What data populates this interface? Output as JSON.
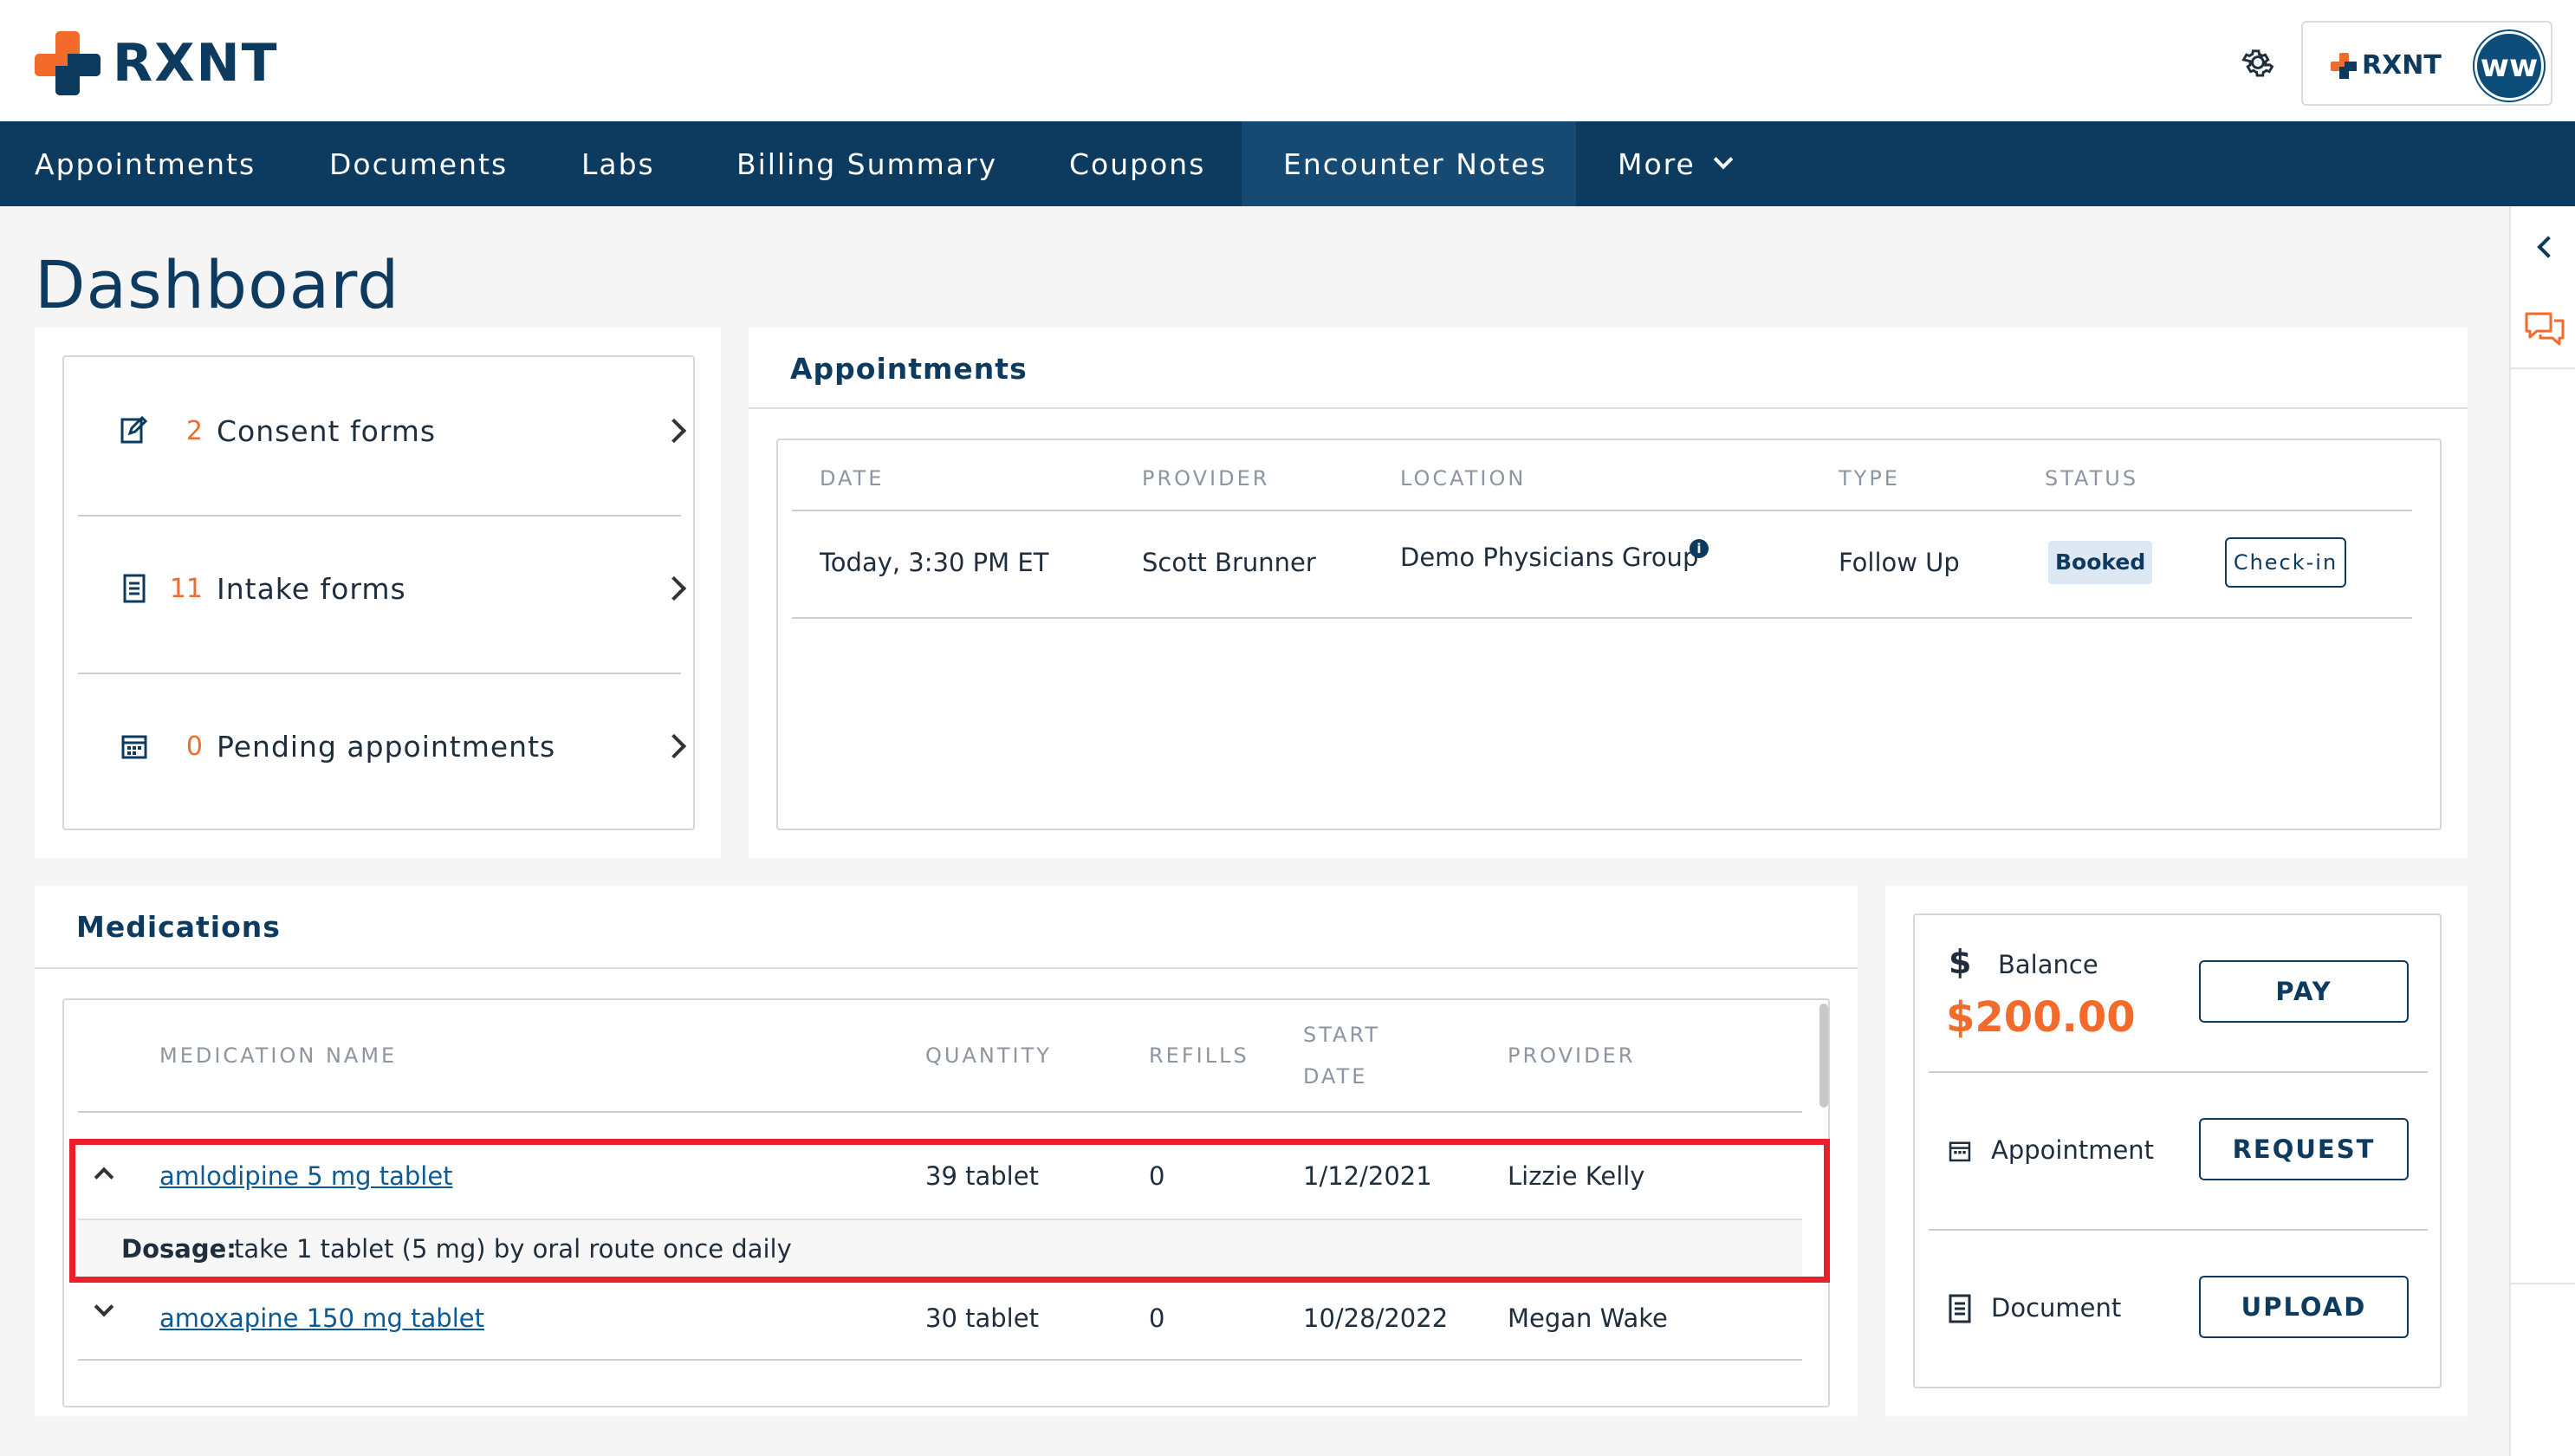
{
  "brand": {
    "name": "RXNT",
    "small_name": "RXNT",
    "orange": "#f26b2a",
    "navy": "#0d3a5f"
  },
  "header": {
    "settings_icon": "gear-icon",
    "avatar_initials": "ww"
  },
  "nav": {
    "items": [
      "Appointments",
      "Documents",
      "Labs",
      "Billing Summary",
      "Coupons",
      "Encounter Notes",
      "More"
    ],
    "active": "Encounter Notes"
  },
  "page": {
    "title": "Dashboard"
  },
  "forms": [
    {
      "count": "2",
      "label": "Consent forms",
      "icon": "edit-document-icon"
    },
    {
      "count": "11",
      "label": "Intake forms",
      "icon": "clipboard-icon"
    },
    {
      "count": "0",
      "label": "Pending appointments",
      "icon": "calendar-icon"
    }
  ],
  "appointments": {
    "title": "Appointments",
    "columns": [
      "DATE",
      "PROVIDER",
      "LOCATION",
      "TYPE",
      "STATUS"
    ],
    "rows": [
      {
        "date": "Today, 3:30 PM ET",
        "provider": "Scott Brunner",
        "location": "Demo Physicians Group",
        "info": "i",
        "type": "Follow Up",
        "status": "Booked",
        "action": "Check-in"
      }
    ]
  },
  "medications": {
    "title": "Medications",
    "columns": {
      "name": "MEDICATION NAME",
      "quantity": "QUANTITY",
      "refills": "REFILLS",
      "start_line1": "START",
      "start_line2": "DATE",
      "provider": "PROVIDER"
    },
    "rows": [
      {
        "name": "amlodipine 5 mg tablet",
        "quantity": "39 tablet",
        "refills": "0",
        "start": "1/12/2021",
        "provider": "Lizzie Kelly",
        "expanded": true,
        "dosage_label": "Dosage:",
        "dosage": "take 1 tablet (5 mg) by oral route once daily"
      },
      {
        "name": "amoxapine 150 mg tablet",
        "quantity": "30 tablet",
        "refills": "0",
        "start": "10/28/2022",
        "provider": "Megan Wake",
        "expanded": false
      }
    ]
  },
  "billing": {
    "balance_icon": "dollar-icon",
    "balance_label": "Balance",
    "balance_amount": "$200.00",
    "pay_label": "PAY",
    "appointment_label": "Appointment",
    "request_label": "REQUEST",
    "document_label": "Document",
    "upload_label": "UPLOAD"
  }
}
